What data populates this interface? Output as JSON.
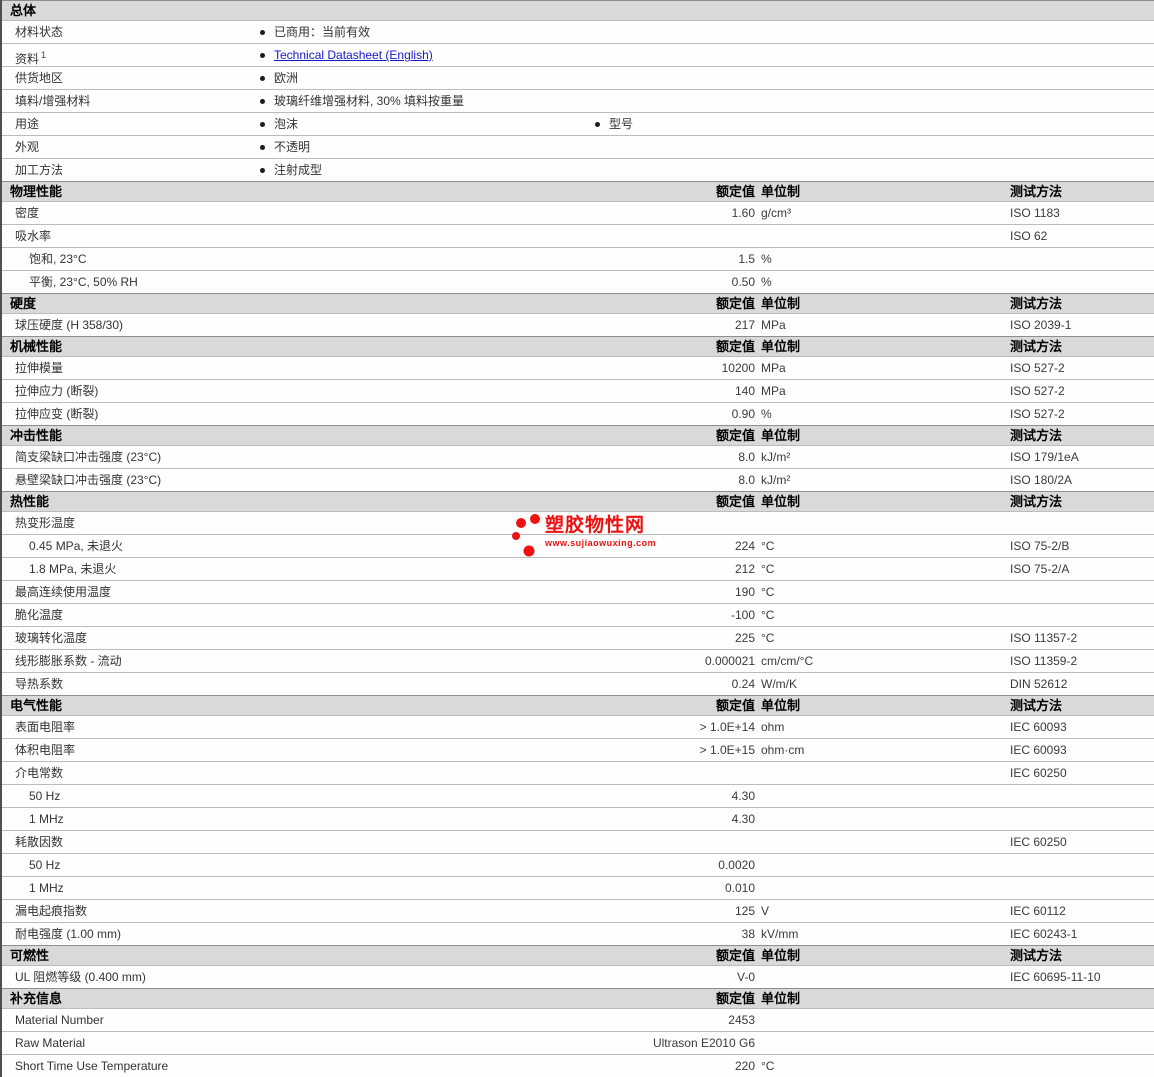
{
  "columns": {
    "value": "额定值",
    "unit": "单位制",
    "method": "测试方法"
  },
  "watermark": {
    "title": "塑胶物性网",
    "url": "www.sujiaowuxing.com",
    "color": "#ee1111"
  },
  "sections": [
    {
      "title": "总体",
      "type": "general",
      "rows": [
        {
          "label": "材料状态",
          "items": [
            {
              "text": "已商用：当前有效"
            }
          ]
        },
        {
          "label": "资料",
          "sup": "1",
          "items": [
            {
              "text": "Technical Datasheet (English)",
              "link": true
            }
          ]
        },
        {
          "label": "供货地区",
          "items": [
            {
              "text": "欧洲"
            }
          ]
        },
        {
          "label": "填料/增强材料",
          "items": [
            {
              "text": "玻璃纤维增强材料, 30% 填料按重量"
            }
          ]
        },
        {
          "label": "用途",
          "items": [
            {
              "text": "泡沫"
            },
            {
              "text": "型号",
              "col": 2
            }
          ]
        },
        {
          "label": "外观",
          "items": [
            {
              "text": "不透明"
            }
          ]
        },
        {
          "label": "加工方法",
          "items": [
            {
              "text": "注射成型"
            }
          ]
        }
      ]
    },
    {
      "title": "物理性能",
      "rows": [
        {
          "label": "密度",
          "value": "1.60",
          "unit": "g/cm³",
          "method": "ISO 1183"
        },
        {
          "label": "吸水率",
          "method": "ISO 62"
        },
        {
          "label": "饱和, 23°C",
          "indent": true,
          "value": "1.5",
          "unit": "%"
        },
        {
          "label": "平衡, 23°C, 50% RH",
          "indent": true,
          "value": "0.50",
          "unit": "%"
        }
      ]
    },
    {
      "title": "硬度",
      "rows": [
        {
          "label": "球压硬度  (H 358/30)",
          "value": "217",
          "unit": "MPa",
          "method": "ISO 2039-1"
        }
      ]
    },
    {
      "title": "机械性能",
      "rows": [
        {
          "label": "拉伸模量",
          "value": "10200",
          "unit": "MPa",
          "method": "ISO 527-2"
        },
        {
          "label": "拉伸应力  (断裂)",
          "value": "140",
          "unit": "MPa",
          "method": "ISO 527-2"
        },
        {
          "label": "拉伸应变  (断裂)",
          "value": "0.90",
          "unit": "%",
          "method": "ISO 527-2"
        }
      ]
    },
    {
      "title": "冲击性能",
      "rows": [
        {
          "label": "简支梁缺口冲击强度  (23°C)",
          "value": "8.0",
          "unit": "kJ/m²",
          "method": "ISO 179/1eA"
        },
        {
          "label": "悬壁梁缺口冲击强度  (23°C)",
          "value": "8.0",
          "unit": "kJ/m²",
          "method": "ISO 180/2A"
        }
      ]
    },
    {
      "title": "热性能",
      "rows": [
        {
          "label": "热变形温度"
        },
        {
          "label": "0.45 MPa, 未退火",
          "indent": true,
          "value": "224",
          "unit": "°C",
          "method": "ISO 75-2/B"
        },
        {
          "label": "1.8 MPa, 未退火",
          "indent": true,
          "value": "212",
          "unit": "°C",
          "method": "ISO 75-2/A"
        },
        {
          "label": "最高连续使用温度",
          "value": "190",
          "unit": "°C"
        },
        {
          "label": "脆化温度",
          "value": "-100",
          "unit": "°C"
        },
        {
          "label": "玻璃转化温度",
          "value": "225",
          "unit": "°C",
          "method": "ISO 11357-2"
        },
        {
          "label": "线形膨胀系数  - 流动",
          "value": "0.000021",
          "unit": "cm/cm/°C",
          "method": "ISO 11359-2"
        },
        {
          "label": "导热系数",
          "value": "0.24",
          "unit": "W/m/K",
          "method": "DIN 52612"
        }
      ]
    },
    {
      "title": "电气性能",
      "rows": [
        {
          "label": "表面电阻率",
          "value": "> 1.0E+14",
          "unit": "ohm",
          "method": "IEC 60093"
        },
        {
          "label": "体积电阻率",
          "value": "> 1.0E+15",
          "unit": "ohm·cm",
          "method": "IEC 60093"
        },
        {
          "label": "介电常数",
          "method": "IEC 60250"
        },
        {
          "label": "50 Hz",
          "indent": true,
          "value": "4.30"
        },
        {
          "label": "1 MHz",
          "indent": true,
          "value": "4.30"
        },
        {
          "label": "耗散因数",
          "method": "IEC 60250"
        },
        {
          "label": "50 Hz",
          "indent": true,
          "value": "0.0020"
        },
        {
          "label": "1 MHz",
          "indent": true,
          "value": "0.010"
        },
        {
          "label": "漏电起痕指数",
          "value": "125",
          "unit": "V",
          "method": "IEC 60112"
        },
        {
          "label": "耐电强度  (1.00 mm)",
          "value": "38",
          "unit": "kV/mm",
          "method": "IEC 60243-1"
        }
      ]
    },
    {
      "title": "可燃性",
      "rows": [
        {
          "label": "UL 阻燃等级  (0.400 mm)",
          "value": "V-0",
          "method": "IEC 60695-11-10"
        }
      ]
    },
    {
      "title": "补充信息",
      "method_header": false,
      "rows": [
        {
          "label": "Material Number",
          "value": "2453"
        },
        {
          "label": "Raw Material",
          "value": "Ultrason E2010 G6"
        },
        {
          "label": "Short Time Use Temperature",
          "value": "220",
          "unit": "°C"
        }
      ]
    }
  ]
}
